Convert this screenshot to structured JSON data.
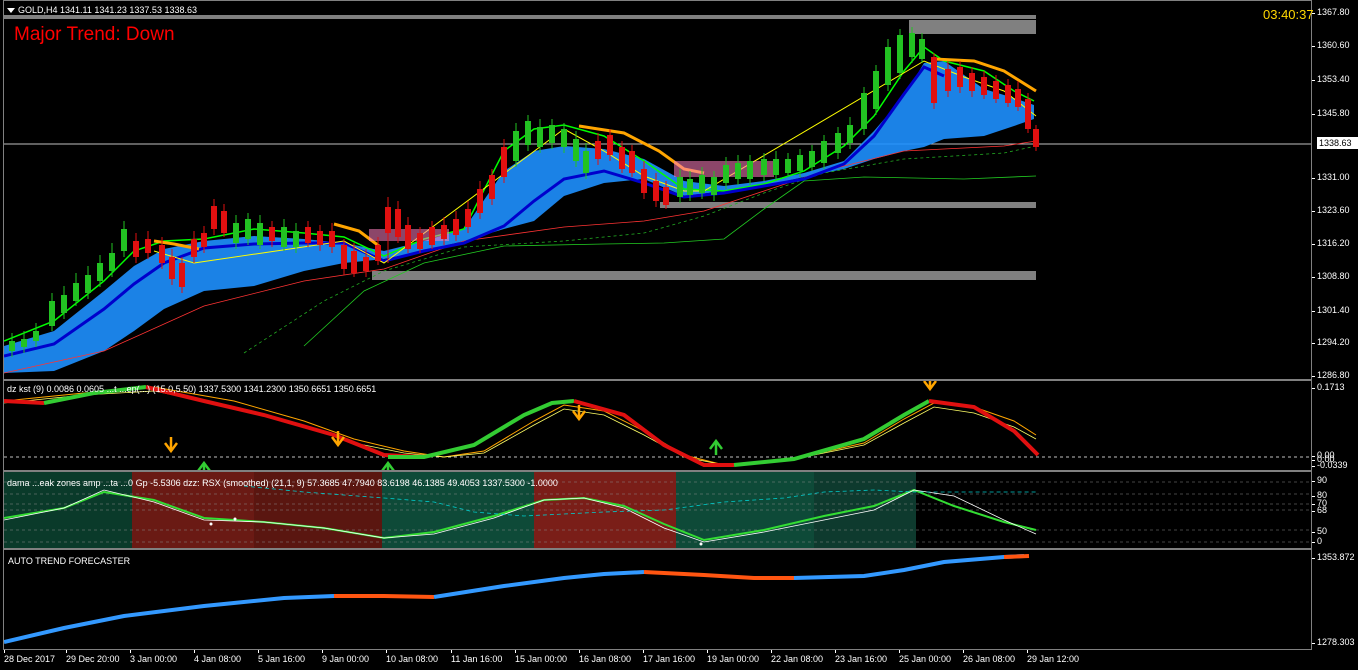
{
  "header": {
    "symbol_info": "GOLD,H4  1341.11 1341.23 1337.53 1338.63",
    "trend_text": "Major Trend: Down",
    "clock": "03:40:37"
  },
  "price_axis": [
    "1367.80",
    "1360.60",
    "1353.40",
    "1345.80",
    "1338.63",
    "1331.00",
    "1323.60",
    "1316.20",
    "1308.80",
    "1301.40",
    "1294.20",
    "1286.80"
  ],
  "current_price": "1338.63",
  "kst": {
    "label": "dz kst (9) 0.0086 0.0605 ...t ...ep(...) (15.0,5.50) 1337.5300 1341.2300 1350.6651 1350.6651",
    "top": "0.1713",
    "zero1": "0.00",
    "zero2": "0.00",
    "bottom": "-0.0339"
  },
  "rsx": {
    "label": "dama  ...eak zones amp  ...ta  ...0  Gp -5.5306  dzz:  RSX (smoothed) (21,1, 9) 57.3685 47.7940 83.6198 46.1385 49.4053 1337.5300 -1.0000",
    "levels": [
      "90",
      "80",
      "70",
      "68",
      "50",
      "0"
    ]
  },
  "forecaster": {
    "label": "AUTO TREND FORECASTER",
    "top": "1353.872",
    "bottom": "1278.303"
  },
  "time_axis": [
    "28 Dec 2017",
    "29 Dec 20:00",
    "3 Jan 00:00",
    "4 Jan 08:00",
    "5 Jan 16:00",
    "9 Jan 00:00",
    "10 Jan 08:00",
    "11 Jan 16:00",
    "15 Jan 00:00",
    "16 Jan 08:00",
    "17 Jan 16:00",
    "19 Jan 00:00",
    "22 Jan 08:00",
    "23 Jan 16:00",
    "25 Jan 00:00",
    "26 Jan 08:00",
    "29 Jan 12:00"
  ],
  "colors": {
    "bull": "#22c222",
    "bear": "#e01010",
    "cloud": "#1e90ff",
    "ma_dark": "#0000cc",
    "orange": "#ffa500",
    "zone": "#808080",
    "trend_text": "#ff0000",
    "clock": "#ffd700"
  }
}
